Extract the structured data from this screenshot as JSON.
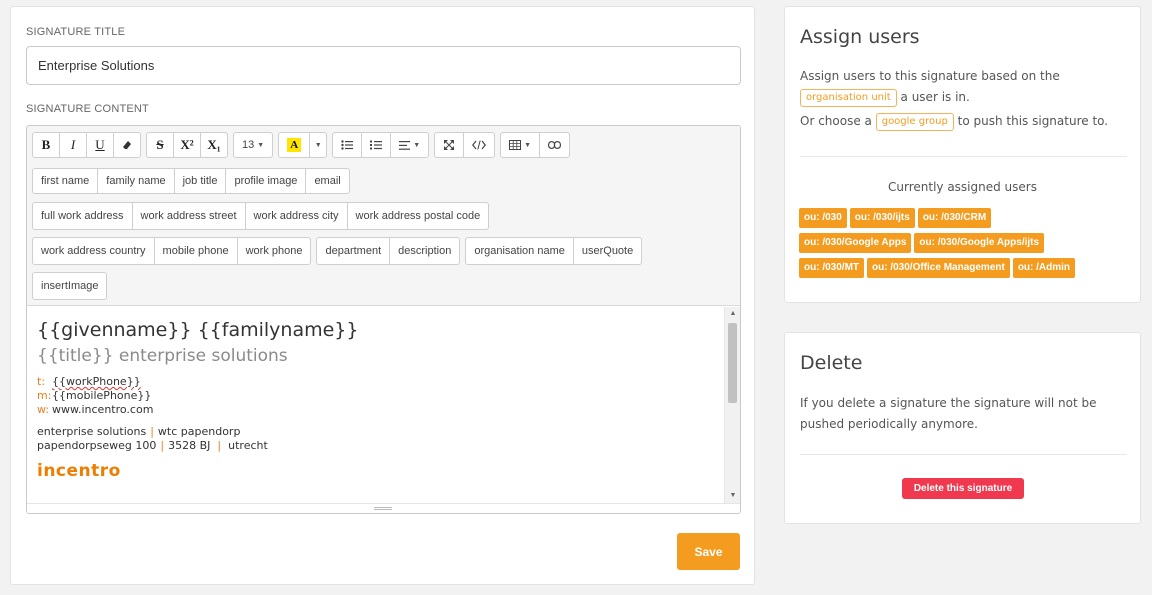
{
  "signature": {
    "title_label": "SIGNATURE TITLE",
    "title_value": "Enterprise Solutions",
    "content_label": "SIGNATURE CONTENT"
  },
  "toolbar": {
    "bold": "B",
    "italic": "I",
    "underline": "U",
    "eraser_icon": "eraser-icon",
    "strike": "S",
    "superscript": "X²",
    "subscript": "X₁",
    "font_size": "13",
    "highlight": "A",
    "tokens_row1": [
      "first name",
      "family name",
      "job title",
      "profile image",
      "email"
    ],
    "tokens_row2": [
      "full work address",
      "work address street",
      "work address city",
      "work address postal code"
    ],
    "tokens_row3a": [
      "work address country",
      "mobile phone",
      "work phone"
    ],
    "tokens_row3b": [
      "department",
      "description"
    ],
    "tokens_row3c": [
      "organisation name",
      "userQuote"
    ],
    "tokens_row4": [
      "insertImage"
    ]
  },
  "content": {
    "name_line": "{{givenname}} {{familyname}}",
    "title_line": "{{title}} enterprise solutions",
    "t_key": "t:",
    "t_val": "{{workPhone}}",
    "m_key": "m:",
    "m_val": "{{mobilePhone}}",
    "w_key": "w:",
    "w_val": "www.incentro.com",
    "addr1_a": "enterprise solutions",
    "addr1_sep": "|",
    "addr1_b": "wtc papendorp",
    "addr2_a": "papendorpseweg 100",
    "addr2_sep1": "|",
    "addr2_b": "3528 BJ",
    "addr2_sep2": "|",
    "addr2_c": "utrecht",
    "logo": "incentro"
  },
  "save_label": "Save",
  "assign": {
    "title": "Assign users",
    "line1_pre": "Assign users to this signature based on the",
    "ou_tag": "organisation unit",
    "line2_post": "a user is in.",
    "line3_pre": "Or choose a",
    "group_tag": "google group",
    "line3_post": "to push this signature to.",
    "assigned_head": "Currently assigned users",
    "badges_row1": [
      "ou: /030",
      "ou: /030/ijts",
      "ou: /030/CRM"
    ],
    "badges_row2": [
      "ou: /030/Google Apps",
      "ou: /030/Google Apps/ijts"
    ],
    "badges_row3": [
      "ou: /030/MT",
      "ou: /030/Office Management",
      "ou: /Admin"
    ]
  },
  "delete": {
    "title": "Delete",
    "desc": "If you delete a signature the signature will not be pushed periodically anymore.",
    "button": "Delete this signature"
  },
  "colors": {
    "accent": "#f39c1f",
    "danger": "#f0394e",
    "highlight": "#ffe500"
  }
}
